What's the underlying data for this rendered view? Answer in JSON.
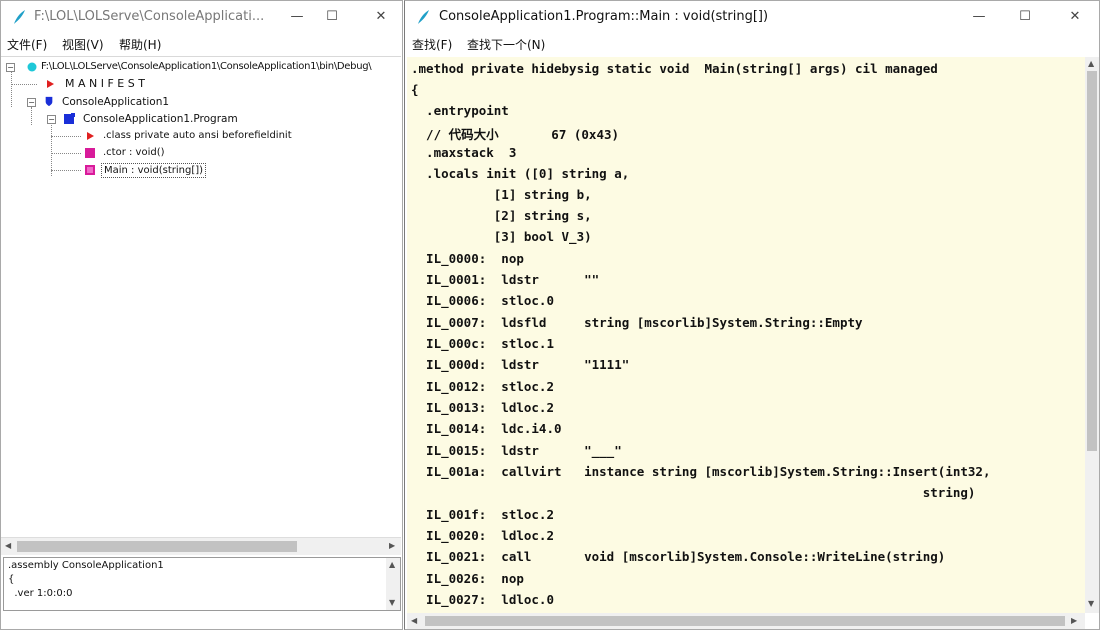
{
  "left_window": {
    "title": "F:\\LOL\\LOLServe\\ConsoleApplicati...",
    "menu": [
      "文件(F)",
      "视图(V)",
      "帮助(H)"
    ],
    "tree": [
      {
        "label": "F:\\LOL\\LOLServe\\ConsoleApplication1\\ConsoleApplication1\\bin\\Debug\\",
        "icon": "assembly-icon",
        "expander": "−"
      },
      {
        "label": "M A N I F E S T",
        "icon": "red-triangle-icon",
        "expander": ""
      },
      {
        "label": "ConsoleApplication1",
        "icon": "namespace-shield-icon",
        "expander": "−"
      },
      {
        "label": "ConsoleApplication1.Program",
        "icon": "class-icon",
        "expander": "−"
      },
      {
        "label": ".class private auto ansi beforefieldinit",
        "icon": "red-triangle-icon",
        "expander": ""
      },
      {
        "label": ".ctor : void()",
        "icon": "method-icon",
        "expander": ""
      },
      {
        "label": "Main : void(string[])",
        "icon": "method-icon",
        "expander": "",
        "selected": true
      }
    ],
    "info_panel": [
      ".assembly ConsoleApplication1",
      "{",
      "  .ver 1:0:0:0"
    ]
  },
  "right_window": {
    "title": "ConsoleApplication1.Program::Main : void(string[])",
    "menu": [
      "查找(F)",
      "查找下一个(N)"
    ],
    "code_lines": [
      ".method private hidebysig static void  Main(string[] args) cil managed",
      "{",
      "  .entrypoint",
      "  // 代码大小       67 (0x43)",
      "  .maxstack  3",
      "  .locals init ([0] string a,",
      "           [1] string b,",
      "           [2] string s,",
      "           [3] bool V_3)",
      "  IL_0000:  nop",
      "  IL_0001:  ldstr      \"\"",
      "  IL_0006:  stloc.0",
      "  IL_0007:  ldsfld     string [mscorlib]System.String::Empty",
      "  IL_000c:  stloc.1",
      "  IL_000d:  ldstr      \"1111\"",
      "  IL_0012:  stloc.2",
      "  IL_0013:  ldloc.2",
      "  IL_0014:  ldc.i4.0",
      "  IL_0015:  ldstr      \"___\"",
      "  IL_001a:  callvirt   instance string [mscorlib]System.String::Insert(int32,",
      "                                                                    string)",
      "  IL_001f:  stloc.2",
      "  IL_0020:  ldloc.2",
      "  IL_0021:  call       void [mscorlib]System.Console::WriteLine(string)",
      "  IL_0026:  nop",
      "  IL_0027:  ldloc.0"
    ]
  },
  "window_controls": {
    "minimize": "—",
    "maximize": "☐",
    "close": "✕"
  },
  "colors": {
    "code_bg": "#fdfbe3",
    "icon_red": "#e02020",
    "icon_blue": "#1a2fd8",
    "icon_magenta": "#d81b9a",
    "icon_cyan": "#1ec8d8"
  }
}
